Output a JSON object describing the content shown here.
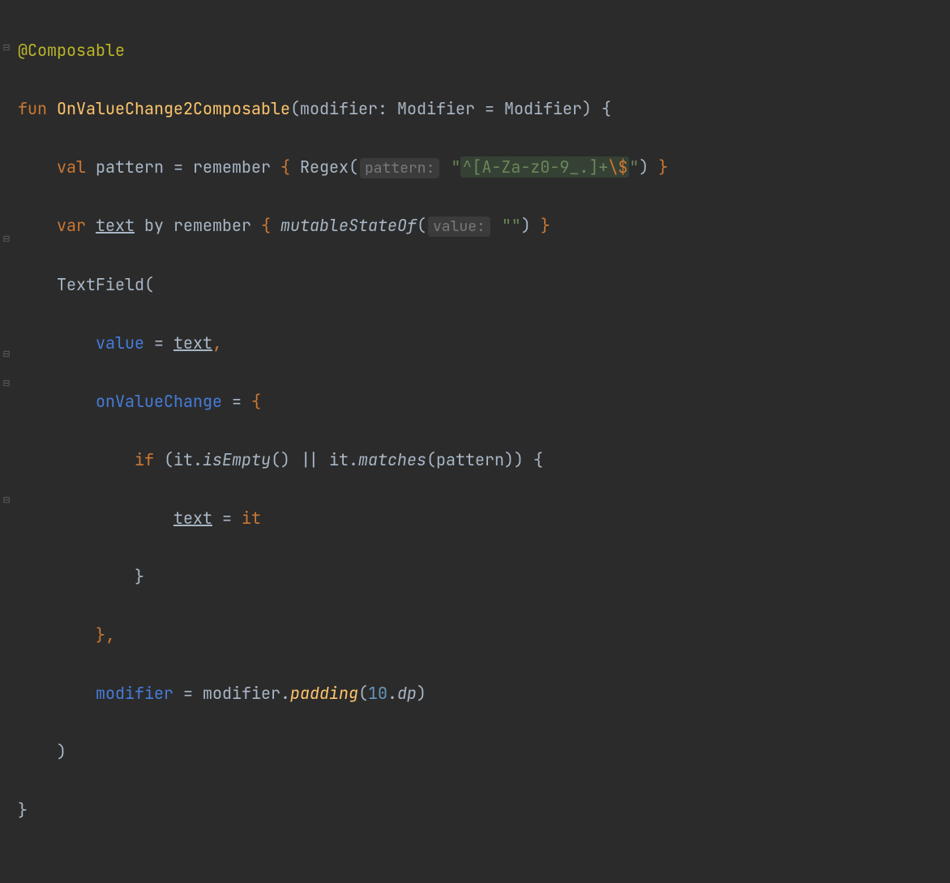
{
  "code": {
    "annotation": "@Composable",
    "kw_fun": "fun",
    "func_name": "OnValueChange2Composable",
    "param_modifier": "modifier",
    "type_modifier": "Modifier",
    "default_modifier": "Modifier",
    "kw_val": "val",
    "var_pattern": "pattern",
    "call_remember": "remember",
    "call_regex": "Regex",
    "hint_pattern": "pattern:",
    "regex_open": "\"",
    "regex_body": "^[A-Za-z0-9_.]+",
    "regex_escape": "\\$",
    "regex_close": "\"",
    "kw_var": "var",
    "var_text": "text",
    "kw_by": "by",
    "call_mutablestate": "mutableStateOf",
    "hint_value": "value:",
    "empty_string": "\"\"",
    "call_textfield": "TextField",
    "param_value": "value",
    "param_onvaluechange": "onValueChange",
    "kw_if": "if",
    "it": "it",
    "call_isempty": "isEmpty",
    "op_or": "||",
    "call_matches": "matches",
    "param_modifier2": "modifier",
    "call_padding": "padding",
    "num_10": "10",
    "prop_dp": "dp"
  }
}
